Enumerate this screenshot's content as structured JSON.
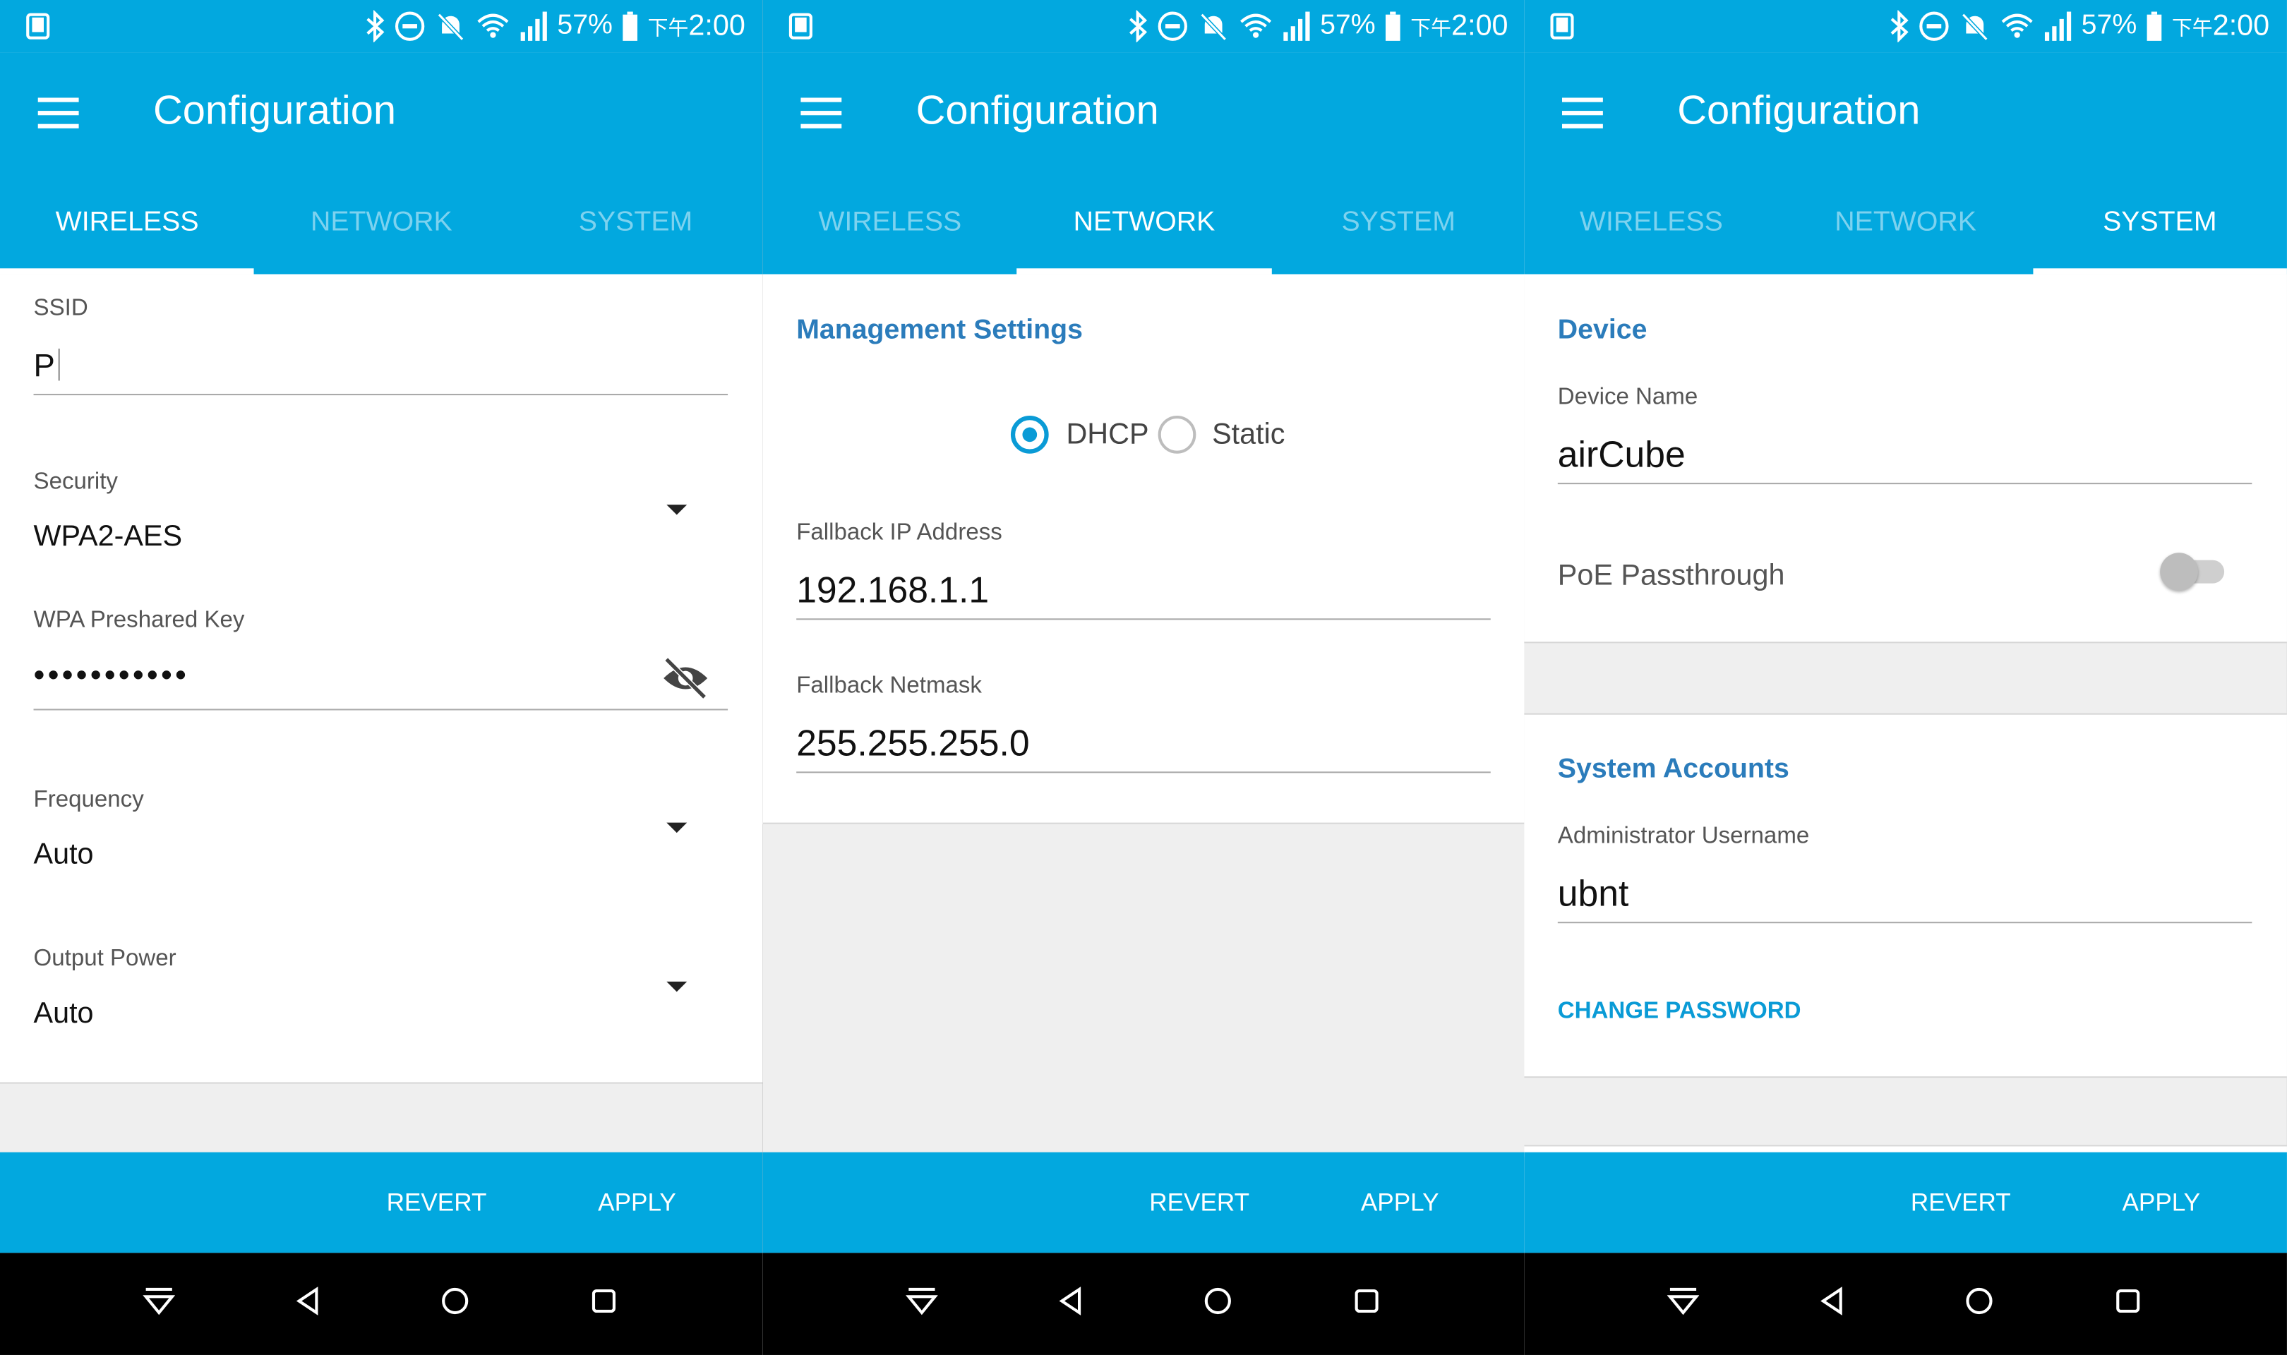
{
  "status": {
    "battery": "57%",
    "time_prefix": "下午",
    "time": "2:00"
  },
  "app": {
    "title": "Configuration"
  },
  "tabs": [
    "WIRELESS",
    "NETWORK",
    "SYSTEM"
  ],
  "actions": {
    "revert": "REVERT",
    "apply": "APPLY"
  },
  "wireless": {
    "ssid_label": "SSID",
    "ssid_value": "P",
    "security_label": "Security",
    "security_value": "WPA2-AES",
    "psk_label": "WPA Preshared Key",
    "psk_value": "•••••••••••",
    "frequency_label": "Frequency",
    "frequency_value": "Auto",
    "power_label": "Output Power",
    "power_value": "Auto"
  },
  "network": {
    "section_title": "Management Settings",
    "dhcp_label": "DHCP",
    "static_label": "Static",
    "selected_mode": "DHCP",
    "fallback_ip_label": "Fallback IP Address",
    "fallback_ip_value": "192.168.1.1",
    "fallback_netmask_label": "Fallback Netmask",
    "fallback_netmask_value": "255.255.255.0"
  },
  "system": {
    "device_title": "Device",
    "device_name_label": "Device Name",
    "device_name_value": "airCube",
    "poe_label": "PoE Passthrough",
    "poe_enabled": false,
    "accounts_title": "System Accounts",
    "admin_user_label": "Administrator Username",
    "admin_user_value": "ubnt",
    "change_password_label": "CHANGE PASSWORD"
  },
  "colors": {
    "primary": "#02a8df",
    "accent": "#0a9bd6",
    "section": "#2b7cbb"
  }
}
